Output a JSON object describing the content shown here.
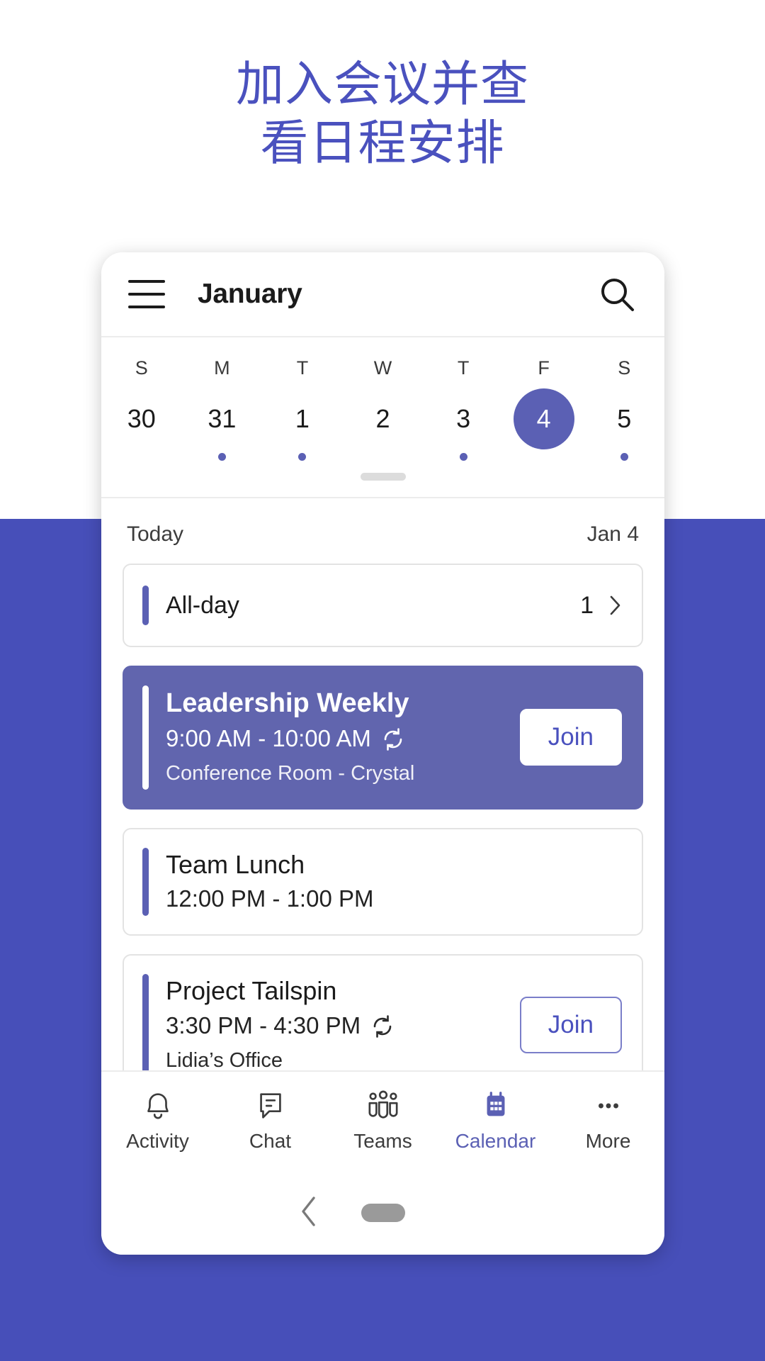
{
  "marketing": {
    "headline_line1": "加入会议并查",
    "headline_line2": "看日程安排",
    "headline_color": "#4A51BE",
    "background_color": "#474FB9"
  },
  "appbar": {
    "menu_icon": "hamburger-icon",
    "title": "January",
    "search_icon": "search-icon"
  },
  "week": {
    "days": [
      {
        "dow": "S",
        "date": "30",
        "selected": false,
        "has_event": false
      },
      {
        "dow": "M",
        "date": "31",
        "selected": false,
        "has_event": true
      },
      {
        "dow": "T",
        "date": "1",
        "selected": false,
        "has_event": true
      },
      {
        "dow": "W",
        "date": "2",
        "selected": false,
        "has_event": false
      },
      {
        "dow": "T",
        "date": "3",
        "selected": false,
        "has_event": true
      },
      {
        "dow": "F",
        "date": "4",
        "selected": true,
        "has_event": false
      },
      {
        "dow": "S",
        "date": "5",
        "selected": false,
        "has_event": true
      }
    ],
    "selected_color": "#5b60b4"
  },
  "agenda": {
    "today_label": "Today",
    "today_date": "Jan 4",
    "allday": {
      "label": "All-day",
      "count": "1",
      "chevron_icon": "chevron-right-icon"
    },
    "events": [
      {
        "title": "Leadership Weekly",
        "time": "9:00 AM - 10:00 AM",
        "location": "Conference Room -  Crystal",
        "recurring": true,
        "active": true,
        "action_label": "Join"
      },
      {
        "title": "Team Lunch",
        "time": "12:00 PM - 1:00 PM",
        "location": "",
        "recurring": false,
        "active": false,
        "action_label": ""
      },
      {
        "title": "Project Tailspin",
        "time": "3:30 PM - 4:30 PM",
        "location": "Lidia’s Office",
        "recurring": true,
        "active": false,
        "action_label": "Join"
      }
    ]
  },
  "fab": {
    "icon": "calendar-add-icon",
    "color": "#5b60b4"
  },
  "bottomnav": {
    "items": [
      {
        "label": "Activity",
        "icon": "bell-icon",
        "selected": false
      },
      {
        "label": "Chat",
        "icon": "chat-icon",
        "selected": false
      },
      {
        "label": "Teams",
        "icon": "teams-icon",
        "selected": false
      },
      {
        "label": "Calendar",
        "icon": "calendar-icon",
        "selected": true
      },
      {
        "label": "More",
        "icon": "more-dots-icon",
        "selected": false
      }
    ],
    "selected_color": "#5b60b4"
  },
  "androidnav": {
    "back_icon": "back-chevron-icon",
    "home_icon": "home-pill-icon"
  }
}
